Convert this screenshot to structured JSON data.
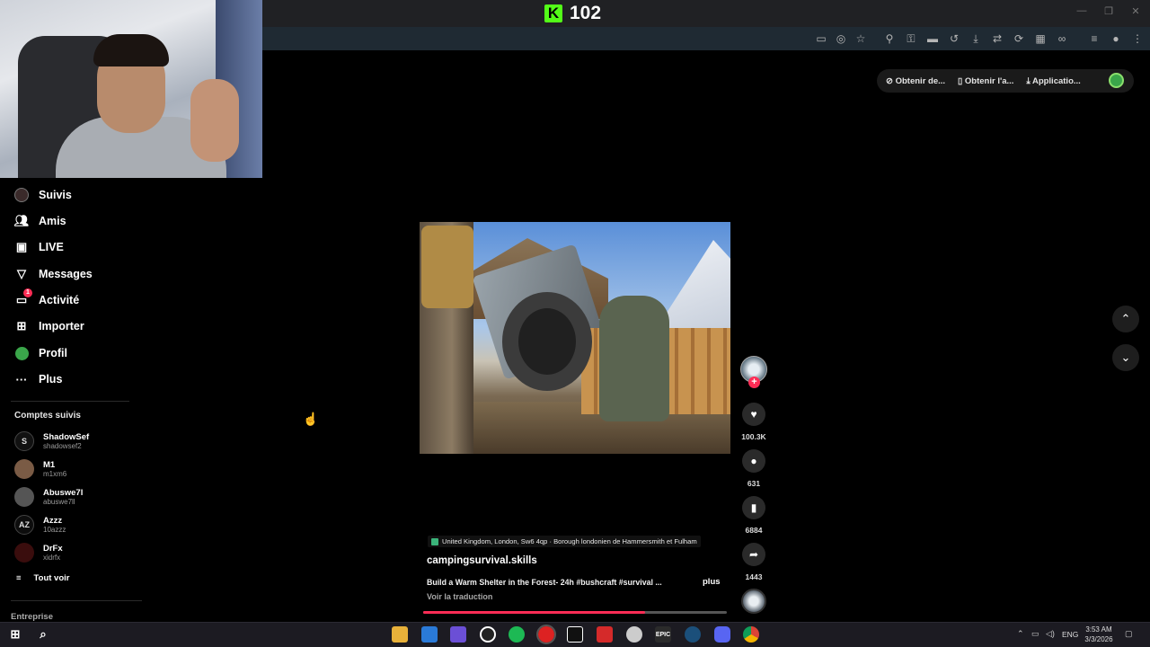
{
  "browser": {
    "kick_viewer_count": "102",
    "kick_logo_letter": "K",
    "accent_kick": "#53fc18"
  },
  "header": {
    "actions": [
      {
        "label": "Obtenir de...",
        "icon": "coin-icon"
      },
      {
        "label": "Obtenir l'a...",
        "icon": "phone-icon"
      },
      {
        "label": "Applicatio...",
        "icon": "download-icon"
      }
    ]
  },
  "sidebar": {
    "items": [
      {
        "label": "Suivis",
        "icon": "following-icon"
      },
      {
        "label": "Amis",
        "icon": "friends-icon"
      },
      {
        "label": "LIVE",
        "icon": "live-icon"
      },
      {
        "label": "Messages",
        "icon": "messages-icon"
      },
      {
        "label": "Activité",
        "icon": "activity-icon",
        "badge": "1"
      },
      {
        "label": "Importer",
        "icon": "upload-icon"
      },
      {
        "label": "Profil",
        "icon": "profile-icon"
      },
      {
        "label": "Plus",
        "icon": "more-icon"
      }
    ],
    "following_title": "Comptes suivis",
    "accounts": [
      {
        "name": "ShadowSef",
        "handle": "shadowsef2",
        "avatar": "S"
      },
      {
        "name": "M1",
        "handle": "m1xm6",
        "avatar": ""
      },
      {
        "name": "Abuswe7l",
        "handle": "abuswe7ll",
        "avatar": ""
      },
      {
        "name": "Azzz",
        "handle": "10azzz",
        "avatar": "AZ"
      },
      {
        "name": "DrFx",
        "handle": "xidrfx",
        "avatar": ""
      }
    ],
    "see_all": "Tout voir",
    "footer_section": "Entreprise"
  },
  "video": {
    "location": "United Kingdom, London, Sw6 4qp · Borough londonien de Hammersmith et Fulham",
    "author": "campingsurvival.skills",
    "description": "Build a Warm Shelter in the Forest- 24h #bushcraft #survival ...",
    "more_label": "plus",
    "translate_label": "Voir la traduction",
    "progress": 0.73,
    "likes": "100.3K",
    "comments": "631",
    "saves": "6884",
    "shares": "1443",
    "accent": "#fe2c55"
  },
  "taskbar": {
    "apps": [
      "file-explorer-icon",
      "store-icon",
      "game-icon",
      "obs-icon",
      "spotify-icon",
      "chrome-red-icon",
      "capcut-icon",
      "app-red-icon",
      "app-circle-icon",
      "epic-games-icon",
      "steam-icon",
      "discord-icon",
      "chrome-icon"
    ],
    "epic_label": "EPIC",
    "lang": "ENG",
    "time": "3:53 AM",
    "date": "3/3/2026"
  }
}
